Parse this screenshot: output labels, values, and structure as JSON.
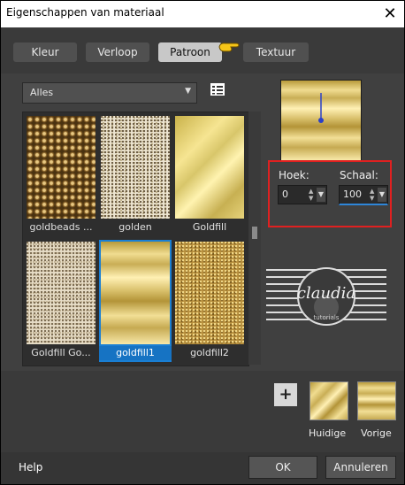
{
  "window": {
    "title": "Eigenschappen van materiaal",
    "close_glyph": "✕"
  },
  "tabs": [
    {
      "label": "Kleur",
      "active": false
    },
    {
      "label": "Verloop",
      "active": false
    },
    {
      "label": "Patroon",
      "active": true
    },
    {
      "label": "Textuur",
      "active": false
    }
  ],
  "category": {
    "selected": "Alles"
  },
  "patterns": [
    {
      "label": "goldbeads ...",
      "selected": false
    },
    {
      "label": "golden",
      "selected": false
    },
    {
      "label": "Goldfill",
      "selected": false
    },
    {
      "label": "Goldfill Go...",
      "selected": false
    },
    {
      "label": "goldfill1",
      "selected": true
    },
    {
      "label": "goldfill2",
      "selected": false
    }
  ],
  "controls": {
    "angle_label": "Hoek:",
    "angle_value": "0",
    "scale_label": "Schaal:",
    "scale_value": "100"
  },
  "watermark": {
    "text": "claudia",
    "subtext": "tutorials"
  },
  "swatches": {
    "current_label": "Huidige",
    "previous_label": "Vorige",
    "add_glyph": "+"
  },
  "footer": {
    "help": "Help",
    "ok": "OK",
    "cancel": "Annuleren"
  },
  "colors": {
    "accent_selection": "#1a7fd4",
    "highlight_box": "#e02020",
    "pointer": "#f5c518"
  }
}
